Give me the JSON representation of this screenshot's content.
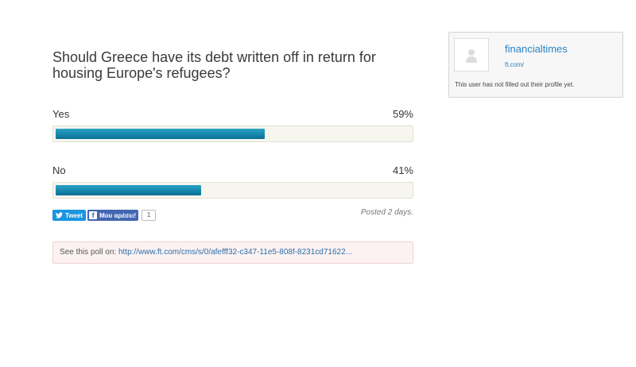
{
  "poll": {
    "question": "Should Greece have its debt written off in return for housing Europe's refugees?",
    "options": [
      {
        "label": "Yes",
        "percent_text": "59%",
        "percent": 59
      },
      {
        "label": "No",
        "percent_text": "41%",
        "percent": 41
      }
    ],
    "posted": "Posted 2 days.",
    "see_on_label": "See this poll on:",
    "see_on_link": "http://www.ft.com/cms/s/0/afefff32-c347-11e5-808f-8231cd71622..."
  },
  "share": {
    "tweet_label": "Tweet",
    "like_label": "Μου αρέσει!",
    "like_count": "1"
  },
  "profile": {
    "username": "financialtimes",
    "site": "ft.com/",
    "bio": "This user has not filled out their profile yet."
  },
  "colors": {
    "bar": "#1a8ab5",
    "link": "#2a84c4",
    "twitter": "#1b95e0",
    "facebook": "#4267b2"
  }
}
